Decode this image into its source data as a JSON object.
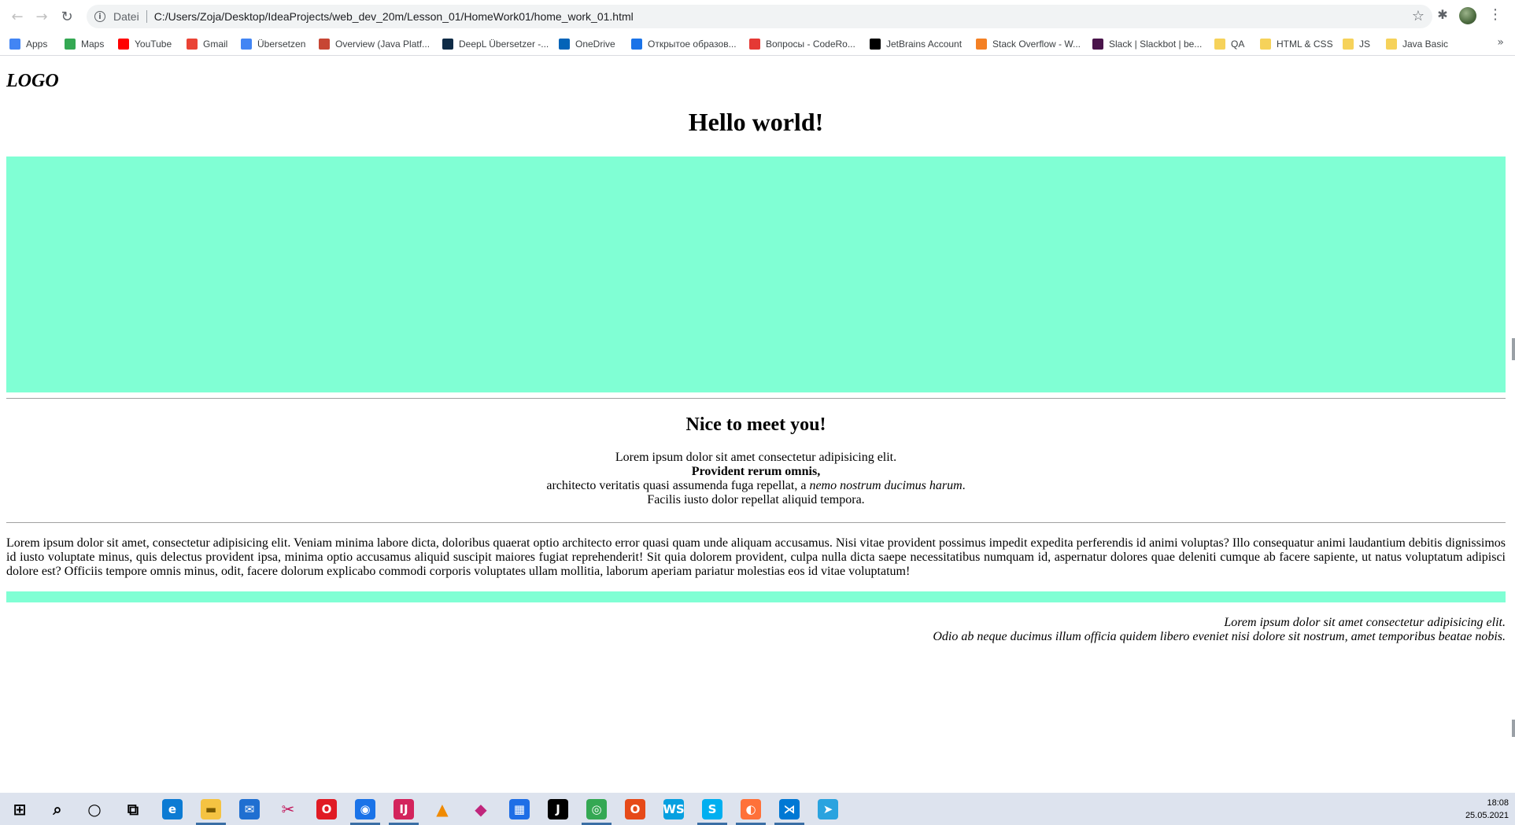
{
  "browser": {
    "scheme_label": "Datei",
    "url": "C:/Users/Zoja/Desktop/IdeaProjects/web_dev_20m/Lesson_01/HomeWork01/home_work_01.html",
    "bookmarks": [
      {
        "label": "Apps",
        "icon": "apps-grid-icon",
        "color": "#4285f4"
      },
      {
        "label": "Maps",
        "icon": "maps-pin-icon",
        "color": "#34a853"
      },
      {
        "label": "YouTube",
        "icon": "youtube-icon",
        "color": "#ff0000"
      },
      {
        "label": "Gmail",
        "icon": "gmail-icon",
        "color": "#ea4335"
      },
      {
        "label": "Übersetzen",
        "icon": "translate-icon",
        "color": "#4285f4"
      },
      {
        "label": "Overview (Java Platf...",
        "icon": "oracle-icon",
        "color": "#c74634"
      },
      {
        "label": "DeepL Übersetzer -...",
        "icon": "deepl-icon",
        "color": "#0f2b46"
      },
      {
        "label": "OneDrive",
        "icon": "onedrive-icon",
        "color": "#0364b8"
      },
      {
        "label": "Открытое образов...",
        "icon": "openedu-icon",
        "color": "#1a73e8"
      },
      {
        "label": "Вопросы - CodeRo...",
        "icon": "coderoad-icon",
        "color": "#e53935"
      },
      {
        "label": "JetBrains Account",
        "icon": "jetbrains-icon",
        "color": "#000000"
      },
      {
        "label": "Stack Overflow - W...",
        "icon": "stackoverflow-icon",
        "color": "#f48024"
      },
      {
        "label": "Slack | Slackbot | be...",
        "icon": "slack-icon",
        "color": "#4a154b"
      },
      {
        "label": "QA",
        "icon": "folder-icon",
        "color": "#f6d25a"
      },
      {
        "label": "HTML & CSS",
        "icon": "folder-icon",
        "color": "#f6d25a"
      },
      {
        "label": "JS",
        "icon": "folder-icon",
        "color": "#f6d25a"
      },
      {
        "label": "Java Basic",
        "icon": "folder-icon",
        "color": "#f6d25a"
      }
    ],
    "more_glyph": "»"
  },
  "page": {
    "logo": "LOGO",
    "hello": "Hello world!",
    "accent_color": "#80ffd4",
    "nice": "Nice to meet you!",
    "center_lines": {
      "line1": "Lorem ipsum dolor sit amet consectetur adipisicing elit.",
      "line2": "Provident rerum omnis,",
      "line3_plain": "architecto veritatis quasi assumenda fuga repellat, a ",
      "line3_italic": "nemo nostrum ducimus harum",
      "line3_end": ".",
      "line4": "Facilis iusto dolor repellat aliquid tempora."
    },
    "justified_text": "Lorem ipsum dolor sit amet, consectetur adipisicing elit. Veniam minima labore dicta, doloribus quaerat optio architecto error quasi quam unde aliquam accusamus. Nisi vitae provident possimus impedit expedita perferendis id animi voluptas? Illo consequatur animi laudantium debitis dignissimos id iusto voluptate minus, quis delectus provident ipsa, minima optio accusamus aliquid suscipit maiores fugiat reprehenderit! Sit quia dolorem provident, culpa nulla dicta saepe necessitatibus numquam id, aspernatur dolores quae deleniti cumque ab facere sapiente, ut natus voluptatum adipisci dolore est? Officiis tempore omnis minus, odit, facere dolorum explicabo commodi corporis voluptates ullam mollitia, laborum aperiam pariatur molestias eos id vitae voluptatum!",
    "right_lines": {
      "line1": "Lorem ipsum dolor sit amet consectetur adipisicing elit.",
      "line2": "Odio ab neque ducimus illum officia quidem libero eveniet nisi dolore sit nostrum, amet temporibus beatae nobis."
    }
  },
  "taskbar": {
    "time": "18:08",
    "date": "25.05.2021",
    "apps": [
      {
        "name": "windows-start-icon",
        "glyph": "⊞",
        "color": "#000000",
        "bg": "transparent"
      },
      {
        "name": "search-icon",
        "glyph": "⌕",
        "color": "#000000",
        "bg": "transparent"
      },
      {
        "name": "cortana-icon",
        "glyph": "○",
        "color": "#000000",
        "bg": "transparent"
      },
      {
        "name": "task-view-icon",
        "glyph": "⧉",
        "color": "#000000",
        "bg": "transparent"
      },
      {
        "name": "edge-icon",
        "glyph": "e",
        "color": "#ffffff",
        "bg": "#0c7bd3"
      },
      {
        "name": "file-explorer-icon",
        "glyph": "▬",
        "color": "#7a5a00",
        "bg": "#f5c342"
      },
      {
        "name": "mail-icon",
        "glyph": "✉",
        "color": "#ffffff",
        "bg": "#1f6fd1"
      },
      {
        "name": "snipping-tool-icon",
        "glyph": "✂",
        "color": "#c2185b",
        "bg": "transparent"
      },
      {
        "name": "opera-icon",
        "glyph": "O",
        "color": "#ffffff",
        "bg": "#e01b24"
      },
      {
        "name": "browser-app-icon",
        "glyph": "◉",
        "color": "#ffffff",
        "bg": "#1a73e8"
      },
      {
        "name": "intellij-idea-icon",
        "glyph": "IJ",
        "color": "#ffffff",
        "bg": "#d3245c"
      },
      {
        "name": "vlc-icon",
        "glyph": "▲",
        "color": "#f08a00",
        "bg": "transparent"
      },
      {
        "name": "cube-app-icon",
        "glyph": "◆",
        "color": "#c0267c",
        "bg": "transparent"
      },
      {
        "name": "calendar-icon",
        "glyph": "▦",
        "color": "#ffffff",
        "bg": "#1e6ee6"
      },
      {
        "name": "jetbrains-toolbox-icon",
        "glyph": "J",
        "color": "#ffffff",
        "bg": "#000000"
      },
      {
        "name": "chrome-icon",
        "glyph": "◎",
        "color": "#ffffff",
        "bg": "#34a853"
      },
      {
        "name": "office-icon",
        "glyph": "O",
        "color": "#ffffff",
        "bg": "#e64a19"
      },
      {
        "name": "webstorm-icon",
        "glyph": "WS",
        "color": "#ffffff",
        "bg": "#07a0e0"
      },
      {
        "name": "skype-icon",
        "glyph": "S",
        "color": "#ffffff",
        "bg": "#00aff0"
      },
      {
        "name": "firefox-icon",
        "glyph": "◐",
        "color": "#ffffff",
        "bg": "#ff7139"
      },
      {
        "name": "vscode-icon",
        "glyph": "⋊",
        "color": "#ffffff",
        "bg": "#0078d4"
      },
      {
        "name": "telegram-icon",
        "glyph": "➤",
        "color": "#ffffff",
        "bg": "#2aa3df"
      }
    ]
  }
}
